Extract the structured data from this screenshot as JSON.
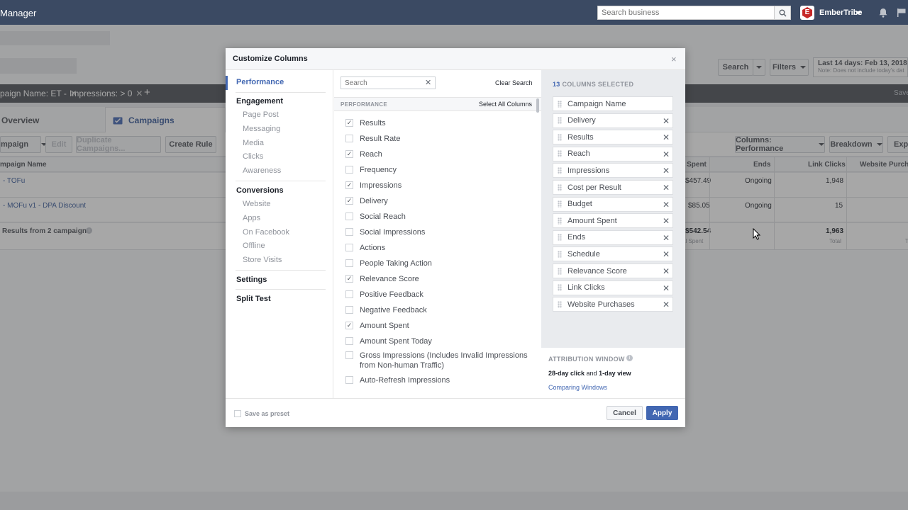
{
  "topbar": {
    "app_title": "Manager",
    "search_placeholder": "Search business",
    "account_name": "EmberTribe"
  },
  "page": {
    "search_button": "Search",
    "filters_button": "Filters",
    "date_range": "Last 14 days: Feb 13, 2018 – F",
    "date_note": "Note: Does not include today's dat",
    "save_link": "Save",
    "filter_chips": [
      {
        "label": "paign Name:  ET -"
      },
      {
        "label": "Impressions:  >  0"
      }
    ],
    "tabs": {
      "overview": "Overview",
      "campaigns": "Campaigns"
    },
    "toolbar": {
      "campaign": "mpaign",
      "edit": "Edit",
      "duplicate": "Duplicate Campaigns...",
      "create_rule": "Create Rule",
      "columns": "Columns: Performance",
      "breakdown": "Breakdown",
      "export": "Expo"
    },
    "table": {
      "headers": {
        "name": "mpaign Name",
        "amount_spent": "t Spent",
        "ends": "Ends",
        "link_clicks": "Link Clicks",
        "website_purchases": "Website Purcha"
      },
      "rows": [
        {
          "name": "- TOFu",
          "spent": "$457.49",
          "ends": "Ongoing",
          "clicks": "1,948"
        },
        {
          "name": "- MOFu v1 - DPA Discount",
          "spent": "$85.05",
          "ends": "Ongoing",
          "clicks": "15"
        }
      ],
      "summary": {
        "name": "Results from 2 campaigns",
        "spent": "$542.54",
        "spent_note": "al Spent",
        "clicks": "1,963",
        "clicks_note": "Total",
        "purchases_note": "T"
      }
    }
  },
  "modal": {
    "title": "Customize Columns",
    "close": "×",
    "nav": {
      "performance": "Performance",
      "engagement": "Engagement",
      "engagement_items": [
        "Page Post",
        "Messaging",
        "Media",
        "Clicks",
        "Awareness"
      ],
      "conversions": "Conversions",
      "conversions_items": [
        "Website",
        "Apps",
        "On Facebook",
        "Offline",
        "Store Visits"
      ],
      "settings": "Settings",
      "split_test": "Split Test"
    },
    "search_placeholder": "Search",
    "clear_search": "Clear Search",
    "section_label": "PERFORMANCE",
    "select_all": "Select All Columns",
    "options": [
      {
        "label": "Results",
        "checked": true
      },
      {
        "label": "Result Rate",
        "checked": false
      },
      {
        "label": "Reach",
        "checked": true
      },
      {
        "label": "Frequency",
        "checked": false
      },
      {
        "label": "Impressions",
        "checked": true
      },
      {
        "label": "Delivery",
        "checked": true
      },
      {
        "label": "Social Reach",
        "checked": false
      },
      {
        "label": "Social Impressions",
        "checked": false
      },
      {
        "label": "Actions",
        "checked": false
      },
      {
        "label": "People Taking Action",
        "checked": false
      },
      {
        "label": "Relevance Score",
        "checked": true
      },
      {
        "label": "Positive Feedback",
        "checked": false
      },
      {
        "label": "Negative Feedback",
        "checked": false
      },
      {
        "label": "Amount Spent",
        "checked": true
      },
      {
        "label": "Amount Spent Today",
        "checked": false
      },
      {
        "label": "Gross Impressions (Includes Invalid Impressions from Non-human Traffic)",
        "checked": false
      },
      {
        "label": "Auto-Refresh Impressions",
        "checked": false
      }
    ],
    "selected_count": "13",
    "selected_label": "COLUMNS SELECTED",
    "selected": [
      {
        "label": "Campaign Name",
        "removable": false
      },
      {
        "label": "Delivery",
        "removable": true
      },
      {
        "label": "Results",
        "removable": true
      },
      {
        "label": "Reach",
        "removable": true
      },
      {
        "label": "Impressions",
        "removable": true
      },
      {
        "label": "Cost per Result",
        "removable": true
      },
      {
        "label": "Budget",
        "removable": true
      },
      {
        "label": "Amount Spent",
        "removable": true
      },
      {
        "label": "Ends",
        "removable": true
      },
      {
        "label": "Schedule",
        "removable": true
      },
      {
        "label": "Relevance Score",
        "removable": true
      },
      {
        "label": "Link Clicks",
        "removable": true
      },
      {
        "label": "Website Purchases",
        "removable": true
      }
    ],
    "attribution": {
      "title": "ATTRIBUTION WINDOW",
      "value_a": "28-day click",
      "value_and": " and ",
      "value_b": "1-day view",
      "link": "Comparing Windows"
    },
    "footer": {
      "save_preset": "Save as preset",
      "cancel": "Cancel",
      "apply": "Apply"
    }
  },
  "colors": {
    "accent": "#4267b2",
    "topbar": "#3b4a63",
    "brand": "#c62828"
  }
}
